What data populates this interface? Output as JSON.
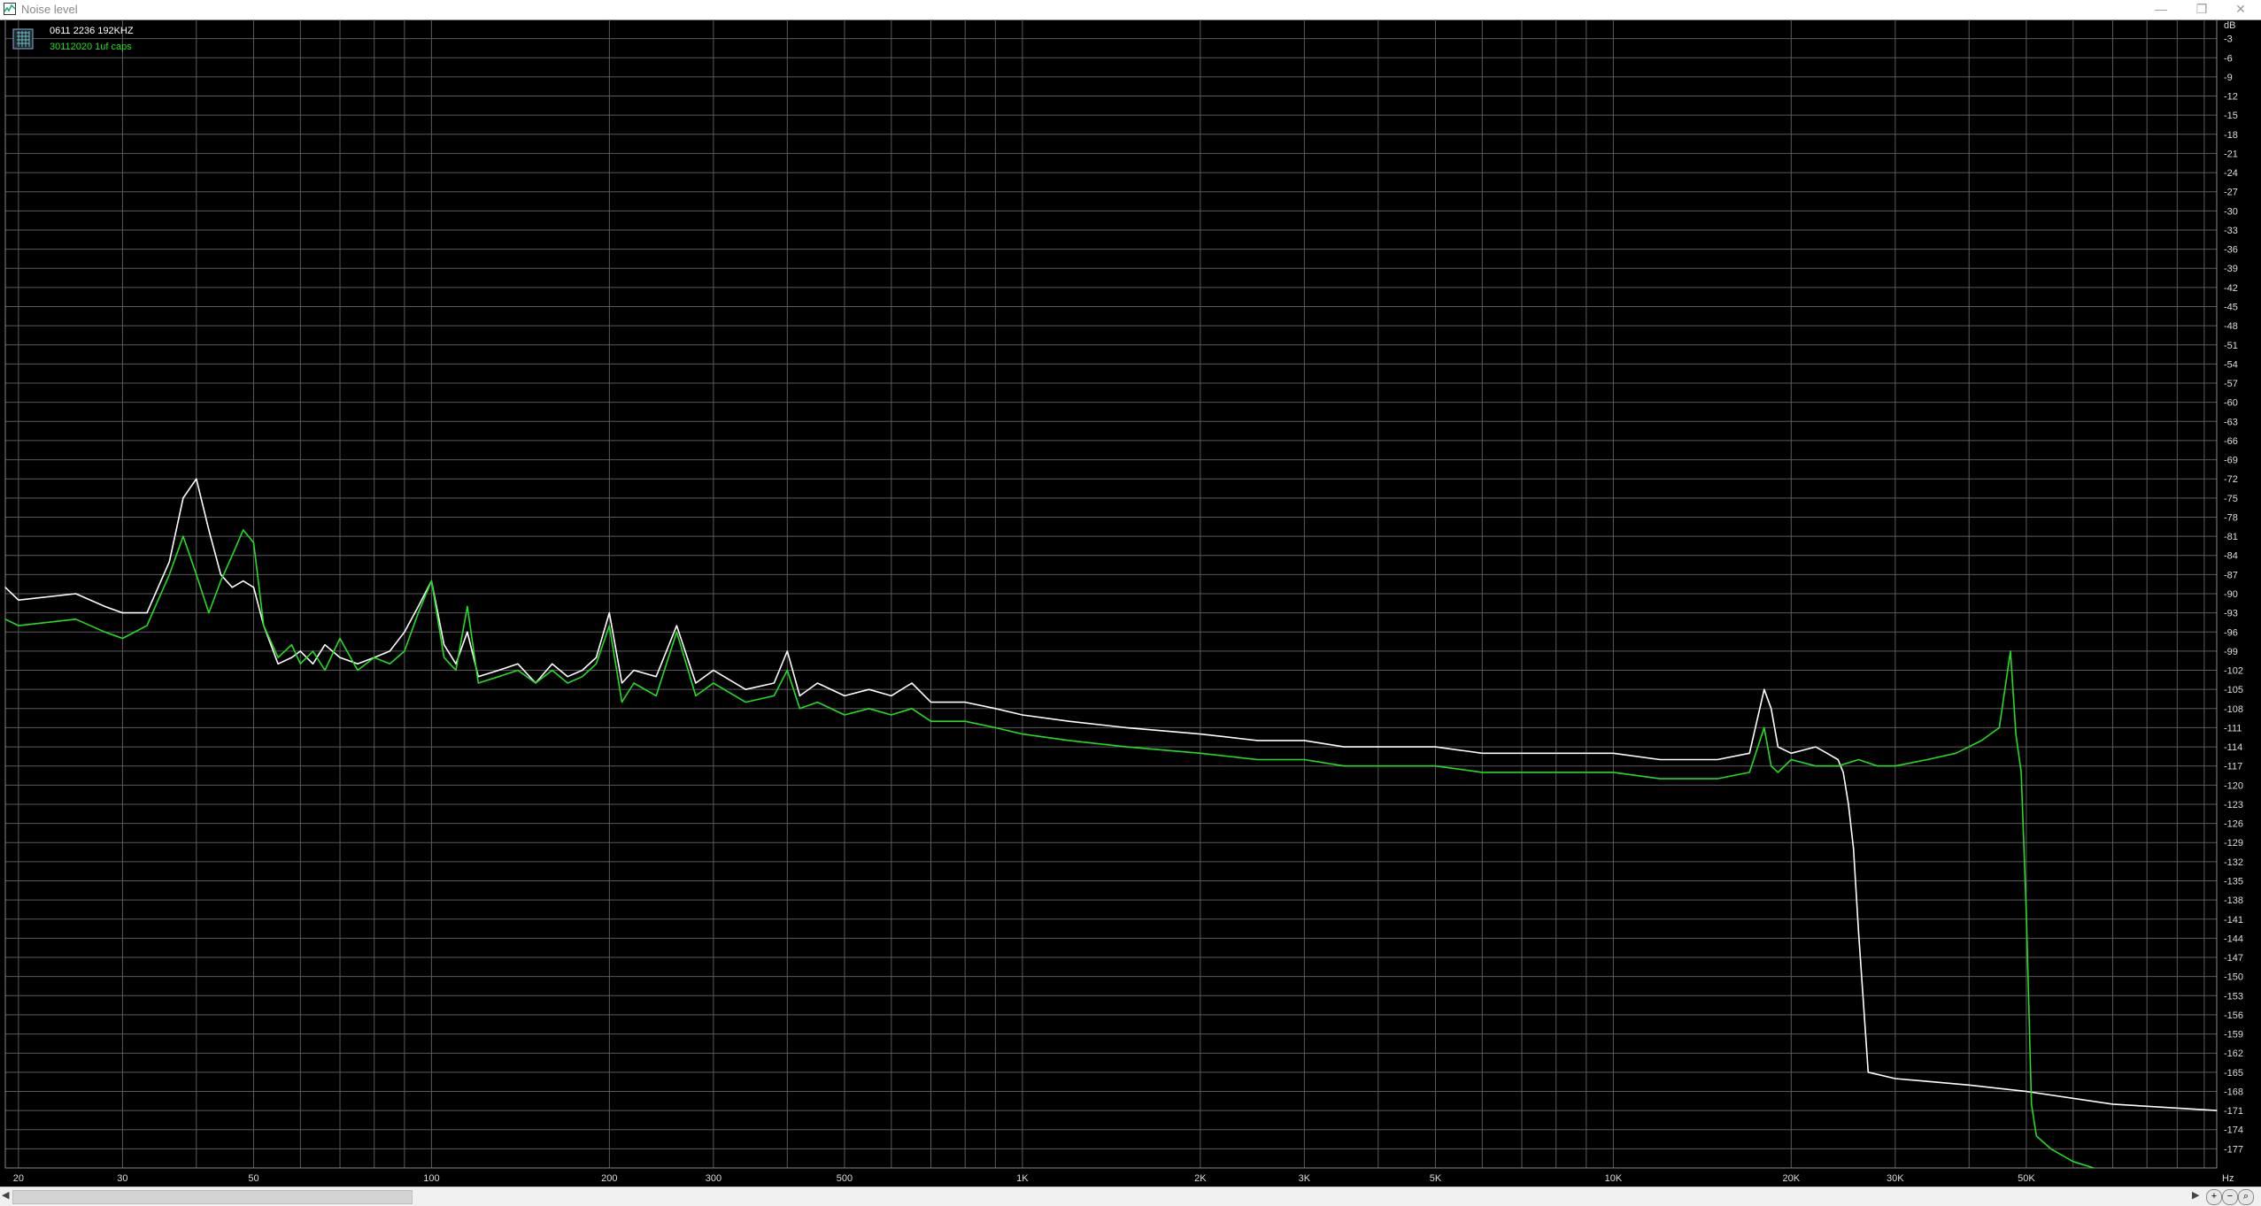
{
  "window": {
    "title": "Noise level",
    "minimize_icon": "minimize-icon",
    "restore_icon": "restore-icon",
    "close_icon": "close-icon"
  },
  "legend": {
    "icon": "grid-icon",
    "entries": [
      {
        "label": "0611 2236 192KHZ",
        "color": "#ffffff"
      },
      {
        "label": "30112020 1uf caps",
        "color": "#22dd22"
      }
    ]
  },
  "chart_data": {
    "type": "line",
    "xscale": "log",
    "xlim": [
      19,
      105000
    ],
    "ylim": [
      -180,
      0
    ],
    "yunit": "dB",
    "xunit": "Hz",
    "grid": true,
    "legend_position": "top-left",
    "x_tick_labels": [
      {
        "v": 20,
        "t": "20"
      },
      {
        "v": 30,
        "t": "30"
      },
      {
        "v": 50,
        "t": "50"
      },
      {
        "v": 100,
        "t": "100"
      },
      {
        "v": 200,
        "t": "200"
      },
      {
        "v": 300,
        "t": "300"
      },
      {
        "v": 500,
        "t": "500"
      },
      {
        "v": 1000,
        "t": "1K"
      },
      {
        "v": 2000,
        "t": "2K"
      },
      {
        "v": 3000,
        "t": "3K"
      },
      {
        "v": 5000,
        "t": "5K"
      },
      {
        "v": 10000,
        "t": "10K"
      },
      {
        "v": 20000,
        "t": "20K"
      },
      {
        "v": 30000,
        "t": "30K"
      },
      {
        "v": 50000,
        "t": "50K"
      }
    ],
    "y_tick_labels": [
      "-3",
      "-6",
      "-9",
      "-12",
      "-15",
      "-18",
      "-21",
      "-24",
      "-27",
      "-30",
      "-33",
      "-36",
      "-39",
      "-42",
      "-45",
      "-48",
      "-51",
      "-54",
      "-57",
      "-60",
      "-63",
      "-66",
      "-69",
      "-72",
      "-75",
      "-78",
      "-81",
      "-84",
      "-87",
      "-90",
      "-93",
      "-96",
      "-99",
      "-102",
      "-105",
      "-108",
      "-111",
      "-114",
      "-117",
      "-120",
      "-123",
      "-126",
      "-129",
      "-132",
      "-135",
      "-138",
      "-141",
      "-144",
      "-147",
      "-150",
      "-153",
      "-156",
      "-159",
      "-162",
      "-165",
      "-168",
      "-171",
      "-174",
      "-177"
    ],
    "series": [
      {
        "name": "0611 2236 192KHZ",
        "color": "#ffffff",
        "x": [
          19,
          20,
          25,
          28,
          30,
          33,
          36,
          38,
          40,
          42,
          44,
          46,
          48,
          50,
          52,
          55,
          58,
          60,
          63,
          66,
          70,
          75,
          80,
          85,
          90,
          95,
          100,
          105,
          110,
          115,
          120,
          130,
          140,
          150,
          160,
          170,
          180,
          190,
          200,
          210,
          220,
          240,
          260,
          280,
          300,
          340,
          380,
          400,
          420,
          450,
          500,
          550,
          600,
          650,
          700,
          800,
          900,
          1000,
          1200,
          1500,
          2000,
          2500,
          3000,
          3500,
          4000,
          5000,
          6000,
          7000,
          8000,
          10000,
          12000,
          15000,
          17000,
          18000,
          18500,
          19000,
          20000,
          22000,
          23000,
          24000,
          24500,
          25000,
          25500,
          26000,
          27000,
          30000,
          40000,
          50000,
          70000,
          105000
        ],
        "y": [
          -89,
          -91,
          -90,
          -92,
          -93,
          -93,
          -85,
          -75,
          -72,
          -80,
          -87,
          -89,
          -88,
          -89,
          -95,
          -101,
          -100,
          -99,
          -101,
          -98,
          -100,
          -101,
          -100,
          -99,
          -96,
          -92,
          -88,
          -98,
          -101,
          -96,
          -103,
          -102,
          -101,
          -104,
          -101,
          -103,
          -102,
          -100,
          -93,
          -104,
          -102,
          -103,
          -95,
          -104,
          -102,
          -105,
          -104,
          -99,
          -106,
          -104,
          -106,
          -105,
          -106,
          -104,
          -107,
          -107,
          -108,
          -109,
          -110,
          -111,
          -112,
          -113,
          -113,
          -114,
          -114,
          -114,
          -115,
          -115,
          -115,
          -115,
          -116,
          -116,
          -115,
          -105,
          -108,
          -114,
          -115,
          -114,
          -115,
          -116,
          -118,
          -123,
          -130,
          -143,
          -165,
          -166,
          -167,
          -168,
          -170,
          -171
        ]
      },
      {
        "name": "30112020 1uf caps",
        "color": "#22dd22",
        "x": [
          19,
          20,
          25,
          28,
          30,
          33,
          36,
          38,
          40,
          42,
          44,
          46,
          48,
          50,
          52,
          55,
          58,
          60,
          63,
          66,
          70,
          75,
          80,
          85,
          90,
          95,
          100,
          105,
          110,
          115,
          120,
          130,
          140,
          150,
          160,
          170,
          180,
          190,
          200,
          210,
          220,
          240,
          260,
          280,
          300,
          340,
          380,
          400,
          420,
          450,
          500,
          550,
          600,
          650,
          700,
          800,
          900,
          1000,
          1200,
          1500,
          2000,
          2500,
          3000,
          3500,
          4000,
          5000,
          6000,
          7000,
          8000,
          10000,
          12000,
          15000,
          17000,
          18000,
          18500,
          19000,
          20000,
          22000,
          24000,
          26000,
          28000,
          30000,
          34000,
          38000,
          42000,
          45000,
          47000,
          48000,
          49000,
          50000,
          51000,
          52000,
          55000,
          60000,
          65000
        ],
        "y": [
          -94,
          -95,
          -94,
          -96,
          -97,
          -95,
          -87,
          -81,
          -87,
          -93,
          -88,
          -84,
          -80,
          -82,
          -95,
          -100,
          -98,
          -101,
          -99,
          -102,
          -97,
          -102,
          -100,
          -101,
          -99,
          -93,
          -88,
          -100,
          -102,
          -92,
          -104,
          -103,
          -102,
          -104,
          -102,
          -104,
          -103,
          -101,
          -95,
          -107,
          -104,
          -106,
          -96,
          -106,
          -104,
          -107,
          -106,
          -102,
          -108,
          -107,
          -109,
          -108,
          -109,
          -108,
          -110,
          -110,
          -111,
          -112,
          -113,
          -114,
          -115,
          -116,
          -116,
          -117,
          -117,
          -117,
          -118,
          -118,
          -118,
          -118,
          -119,
          -119,
          -118,
          -111,
          -117,
          -118,
          -116,
          -117,
          -117,
          -116,
          -117,
          -117,
          -116,
          -115,
          -113,
          -111,
          -99,
          -112,
          -118,
          -140,
          -170,
          -175,
          -177,
          -179,
          -180
        ]
      }
    ]
  }
}
